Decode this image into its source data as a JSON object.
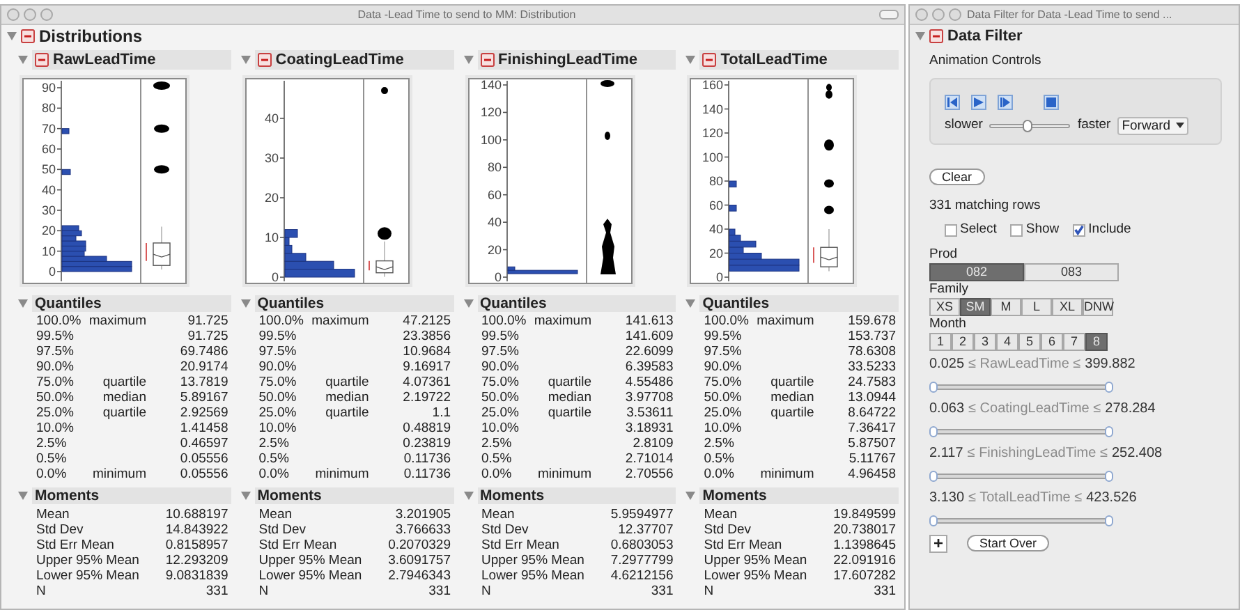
{
  "window": {
    "title": "Data -Lead Time to send to MM: Distribution"
  },
  "distributions": {
    "title": "Distributions",
    "panels": [
      {
        "title": "RawLeadTime",
        "axis_ticks": [
          "90",
          "80",
          "70",
          "60",
          "50",
          "40",
          "30",
          "20",
          "10",
          "0"
        ],
        "quantiles": {
          "title": "Quantiles",
          "rows": [
            {
              "percent": "100.0%",
              "label": "maximum",
              "value": "91.725"
            },
            {
              "percent": "99.5%",
              "value": "91.725"
            },
            {
              "percent": "97.5%",
              "value": "69.7486"
            },
            {
              "percent": "90.0%",
              "value": "20.9174"
            },
            {
              "percent": "75.0%",
              "label": "quartile",
              "value": "13.7819"
            },
            {
              "percent": "50.0%",
              "label": "median",
              "value": "5.89167"
            },
            {
              "percent": "25.0%",
              "label": "quartile",
              "value": "2.92569"
            },
            {
              "percent": "10.0%",
              "value": "1.41458"
            },
            {
              "percent": "2.5%",
              "value": "0.46597"
            },
            {
              "percent": "0.5%",
              "value": "0.05556"
            },
            {
              "percent": "0.0%",
              "label": "minimum",
              "value": "0.05556"
            }
          ]
        },
        "moments": {
          "title": "Moments",
          "rows": [
            {
              "label": "Mean",
              "value": "10.688197"
            },
            {
              "label": "Std Dev",
              "value": "14.843922"
            },
            {
              "label": "Std Err Mean",
              "value": "0.8158957"
            },
            {
              "label": "Upper 95% Mean",
              "value": "12.293209"
            },
            {
              "label": "Lower 95% Mean",
              "value": "9.0831839"
            },
            {
              "label": "N",
              "value": "331"
            }
          ]
        }
      },
      {
        "title": "CoatingLeadTime",
        "axis_ticks": [
          "40",
          "30",
          "20",
          "10",
          "0"
        ],
        "quantiles": {
          "title": "Quantiles",
          "rows": [
            {
              "percent": "100.0%",
              "label": "maximum",
              "value": "47.2125"
            },
            {
              "percent": "99.5%",
              "value": "23.3856"
            },
            {
              "percent": "97.5%",
              "value": "10.9684"
            },
            {
              "percent": "90.0%",
              "value": "9.16917"
            },
            {
              "percent": "75.0%",
              "label": "quartile",
              "value": "4.07361"
            },
            {
              "percent": "50.0%",
              "label": "median",
              "value": "2.19722"
            },
            {
              "percent": "25.0%",
              "label": "quartile",
              "value": "1.1"
            },
            {
              "percent": "10.0%",
              "value": "0.48819"
            },
            {
              "percent": "2.5%",
              "value": "0.23819"
            },
            {
              "percent": "0.5%",
              "value": "0.11736"
            },
            {
              "percent": "0.0%",
              "label": "minimum",
              "value": "0.11736"
            }
          ]
        },
        "moments": {
          "title": "Moments",
          "rows": [
            {
              "label": "Mean",
              "value": "3.201905"
            },
            {
              "label": "Std Dev",
              "value": "3.766633"
            },
            {
              "label": "Std Err Mean",
              "value": "0.2070329"
            },
            {
              "label": "Upper 95% Mean",
              "value": "3.6091757"
            },
            {
              "label": "Lower 95% Mean",
              "value": "2.7946343"
            },
            {
              "label": "N",
              "value": "331"
            }
          ]
        }
      },
      {
        "title": "FinishingLeadTime",
        "axis_ticks": [
          "140",
          "120",
          "100",
          "80",
          "60",
          "40",
          "20",
          "0"
        ],
        "quantiles": {
          "title": "Quantiles",
          "rows": [
            {
              "percent": "100.0%",
              "label": "maximum",
              "value": "141.613"
            },
            {
              "percent": "99.5%",
              "value": "141.609"
            },
            {
              "percent": "97.5%",
              "value": "22.6099"
            },
            {
              "percent": "90.0%",
              "value": "6.39583"
            },
            {
              "percent": "75.0%",
              "label": "quartile",
              "value": "4.55486"
            },
            {
              "percent": "50.0%",
              "label": "median",
              "value": "3.97708"
            },
            {
              "percent": "25.0%",
              "label": "quartile",
              "value": "3.53611"
            },
            {
              "percent": "10.0%",
              "value": "3.18931"
            },
            {
              "percent": "2.5%",
              "value": "2.8109"
            },
            {
              "percent": "0.5%",
              "value": "2.71014"
            },
            {
              "percent": "0.0%",
              "label": "minimum",
              "value": "2.70556"
            }
          ]
        },
        "moments": {
          "title": "Moments",
          "rows": [
            {
              "label": "Mean",
              "value": "5.9594977"
            },
            {
              "label": "Std Dev",
              "value": "12.37707"
            },
            {
              "label": "Std Err Mean",
              "value": "0.6803053"
            },
            {
              "label": "Upper 95% Mean",
              "value": "7.2977799"
            },
            {
              "label": "Lower 95% Mean",
              "value": "4.6212156"
            },
            {
              "label": "N",
              "value": "331"
            }
          ]
        }
      },
      {
        "title": "TotalLeadTime",
        "axis_ticks": [
          "160",
          "140",
          "120",
          "100",
          "80",
          "60",
          "40",
          "20",
          "0"
        ],
        "quantiles": {
          "title": "Quantiles",
          "rows": [
            {
              "percent": "100.0%",
              "label": "maximum",
              "value": "159.678"
            },
            {
              "percent": "99.5%",
              "value": "153.737"
            },
            {
              "percent": "97.5%",
              "value": "78.6308"
            },
            {
              "percent": "90.0%",
              "value": "33.5233"
            },
            {
              "percent": "75.0%",
              "label": "quartile",
              "value": "24.7583"
            },
            {
              "percent": "50.0%",
              "label": "median",
              "value": "13.0944"
            },
            {
              "percent": "25.0%",
              "label": "quartile",
              "value": "8.64722"
            },
            {
              "percent": "10.0%",
              "value": "7.36417"
            },
            {
              "percent": "2.5%",
              "value": "5.87507"
            },
            {
              "percent": "0.5%",
              "value": "5.11767"
            },
            {
              "percent": "0.0%",
              "label": "minimum",
              "value": "4.96458"
            }
          ]
        },
        "moments": {
          "title": "Moments",
          "rows": [
            {
              "label": "Mean",
              "value": "19.849599"
            },
            {
              "label": "Std Dev",
              "value": "20.738017"
            },
            {
              "label": "Std Err Mean",
              "value": "1.1398645"
            },
            {
              "label": "Upper 95% Mean",
              "value": "22.091916"
            },
            {
              "label": "Lower 95% Mean",
              "value": "17.607282"
            },
            {
              "label": "N",
              "value": "331"
            }
          ]
        }
      }
    ]
  },
  "filter_window": {
    "title": "Data Filter for Data -Lead Time to send ...",
    "header": "Data Filter",
    "animation": {
      "title": "Animation Controls",
      "slower": "slower",
      "faster": "faster",
      "speed": {
        "level": 0.45
      },
      "direction": "Forward"
    },
    "clear": "Clear",
    "matching": "331 matching rows",
    "options": [
      {
        "label": "Select",
        "checked": false
      },
      {
        "label": "Show",
        "checked": false
      },
      {
        "label": "Include",
        "checked": true
      }
    ],
    "groups": [
      {
        "title": "Prod",
        "items": [
          {
            "label": "082",
            "selected": true
          },
          {
            "label": "083",
            "selected": false
          }
        ]
      },
      {
        "title": "Family",
        "items": [
          {
            "label": "XS",
            "selected": false
          },
          {
            "label": "SM",
            "selected": true
          },
          {
            "label": "M",
            "selected": false
          },
          {
            "label": "L",
            "selected": false
          },
          {
            "label": "XL",
            "selected": false
          },
          {
            "label": "DNW",
            "selected": false
          }
        ]
      },
      {
        "title": "Month",
        "items": [
          {
            "label": "1",
            "selected": false
          },
          {
            "label": "2",
            "selected": false
          },
          {
            "label": "3",
            "selected": false
          },
          {
            "label": "4",
            "selected": false
          },
          {
            "label": "5",
            "selected": false
          },
          {
            "label": "6",
            "selected": false
          },
          {
            "label": "7",
            "selected": false
          },
          {
            "label": "8",
            "selected": true
          }
        ]
      }
    ],
    "ranges": [
      {
        "low": "0.025",
        "column": "≤ RawLeadTime ≤",
        "high": "399.882",
        "level": 1
      },
      {
        "low": "0.063",
        "column": "≤ CoatingLeadTime ≤",
        "high": "278.284",
        "level": 1
      },
      {
        "low": "2.117",
        "column": "≤ FinishingLeadTime ≤",
        "high": "252.408",
        "level": 1
      },
      {
        "low": "3.130",
        "column": "≤ TotalLeadTime ≤",
        "high": "423.526",
        "level": 1
      }
    ],
    "add_button": "+",
    "start_over": "Start Over"
  }
}
